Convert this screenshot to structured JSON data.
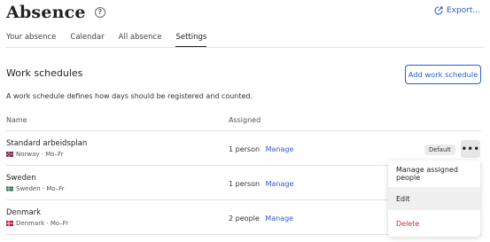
{
  "header": {
    "title": "Absence",
    "help_icon": "?",
    "export_label": "Export..."
  },
  "tabs": [
    {
      "label": "Your absence"
    },
    {
      "label": "Calendar"
    },
    {
      "label": "All absence"
    },
    {
      "label": "Settings",
      "active": true
    }
  ],
  "section": {
    "title": "Work schedules",
    "add_button": "Add work schedule",
    "description": "A work schedule defines how days should be registered and counted."
  },
  "columns": {
    "name": "Name",
    "assigned": "Assigned"
  },
  "rows": [
    {
      "name": "Standard arbeidsplan",
      "sub": "Norway · Mo–Fr",
      "flag": "norway",
      "assigned": "1 person",
      "manage": "Manage",
      "badge": "Default"
    },
    {
      "name": "Sweden",
      "sub": "Sweden · Mo–Fr",
      "flag": "sweden",
      "assigned": "1 person",
      "manage": "Manage"
    },
    {
      "name": "Denmark",
      "sub": "Denmark · Mo–Fr",
      "flag": "denmark",
      "assigned": "2 people",
      "manage": "Manage"
    }
  ],
  "more_button": "•••",
  "menu": {
    "items": [
      {
        "label": "Manage assigned people"
      },
      {
        "label": "Edit"
      },
      {
        "label": "Delete"
      }
    ]
  },
  "colors": {
    "accent": "#2e5bd1",
    "danger": "#c8323c"
  }
}
